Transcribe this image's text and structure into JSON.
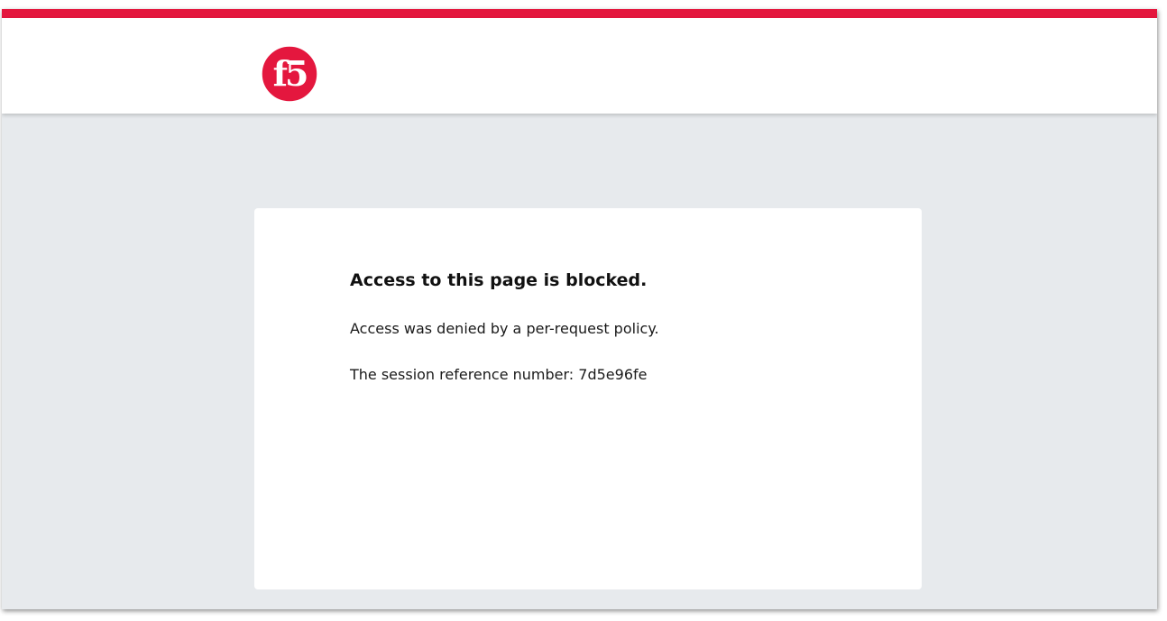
{
  "colors": {
    "brand_red": "#e4173e",
    "page_background": "#e7eaed",
    "card_background": "#ffffff"
  },
  "header": {
    "logo_icon": "f5-logo-icon",
    "logo_text": "f5"
  },
  "card": {
    "title": "Access to this page is blocked.",
    "message": "Access was denied by a per-request policy.",
    "session_label": "The session reference number: 7d5e96fe"
  }
}
